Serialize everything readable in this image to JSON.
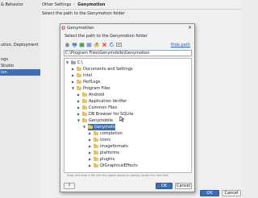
{
  "sidebar": {
    "items": [
      {
        "label": "& Behavior",
        "selected": false
      },
      {
        "label": "ution, Deployment",
        "selected": false
      },
      {
        "label": "ngs",
        "selected": false
      },
      {
        "label": "Studio",
        "selected": false
      },
      {
        "label": "ion",
        "selected": false
      }
    ]
  },
  "settings": {
    "breadcrumb": [
      "Other Settings",
      "Genymotion"
    ],
    "description": "Select the path to the Genymotion folder"
  },
  "dialog": {
    "title": "Genymotion",
    "close_label": "✕",
    "description": "Select the path to the Genymotion folder",
    "hide_path_label": "Hide path",
    "path_value": "C:\\Program Files\\Genymobile\\Genymotion",
    "drop_hint": "Drag and drop a file into the space above to quickly locate it in the tree",
    "ok_label": "OK",
    "cancel_label": "Cancel",
    "help_label": "Help",
    "toolbar_icons": [
      "home-icon",
      "desktop-icon",
      "project-icon",
      "module-icon",
      "new-folder-icon",
      "delete-icon",
      "refresh-icon",
      "show-hidden-icon"
    ],
    "tree": [
      {
        "label": "C:\\",
        "depth": 0,
        "expanded": true,
        "selected": false
      },
      {
        "label": "Documents and Settings",
        "depth": 1,
        "expanded": false,
        "selected": false
      },
      {
        "label": "Intel",
        "depth": 1,
        "expanded": false,
        "selected": false
      },
      {
        "label": "PerfLogs",
        "depth": 1,
        "expanded": false,
        "selected": false
      },
      {
        "label": "Program Files",
        "depth": 1,
        "expanded": true,
        "selected": false
      },
      {
        "label": "Android",
        "depth": 2,
        "expanded": false,
        "selected": false
      },
      {
        "label": "Application Verifier",
        "depth": 2,
        "expanded": false,
        "selected": false
      },
      {
        "label": "Common Files",
        "depth": 2,
        "expanded": false,
        "selected": false
      },
      {
        "label": "DB Browser for SQLite",
        "depth": 2,
        "expanded": false,
        "selected": false
      },
      {
        "label": "Genymobile",
        "depth": 2,
        "expanded": true,
        "selected": false
      },
      {
        "label": "Genymotion",
        "depth": 3,
        "expanded": true,
        "selected": true
      },
      {
        "label": "completion",
        "depth": 4,
        "expanded": false,
        "selected": false
      },
      {
        "label": "icons",
        "depth": 4,
        "expanded": false,
        "selected": false
      },
      {
        "label": "imageformats",
        "depth": 4,
        "expanded": false,
        "selected": false
      },
      {
        "label": "platforms",
        "depth": 4,
        "expanded": false,
        "selected": false
      },
      {
        "label": "plugins",
        "depth": 4,
        "expanded": false,
        "selected": false
      },
      {
        "label": "QtGraphicalEffects",
        "depth": 4,
        "expanded": false,
        "selected": false
      }
    ]
  },
  "footer": {
    "ok_label": "OK",
    "cancel_label": "Cancel"
  },
  "colors": {
    "accent": "#3d6fb4",
    "folder": "#e7c35a",
    "link": "#2d5fb4"
  }
}
